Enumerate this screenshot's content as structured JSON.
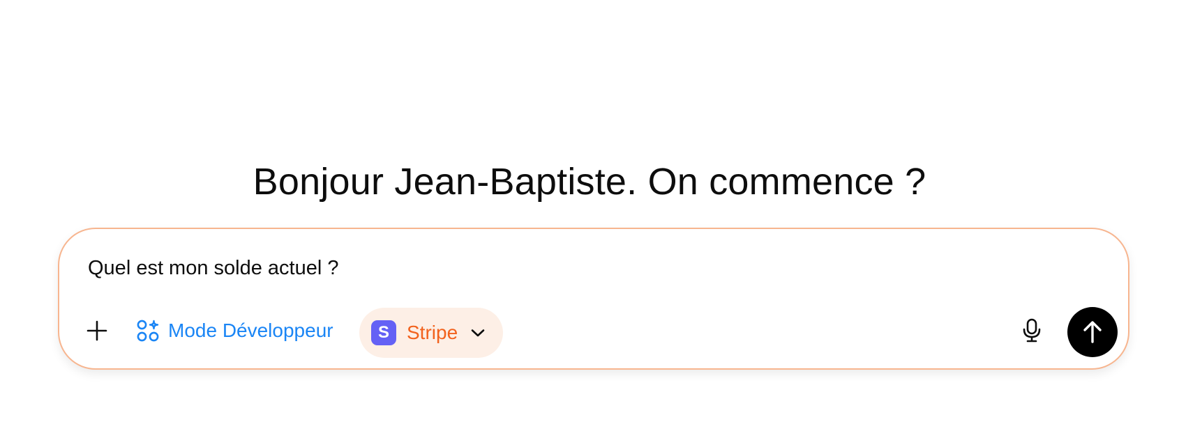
{
  "greeting": "Bonjour Jean-Baptiste. On commence ?",
  "composer": {
    "input_value": "Quel est mon solde actuel ?",
    "dev_mode_label": "Mode Développeur",
    "connector": {
      "label": "Stripe",
      "logo_letter": "S"
    },
    "icons": {
      "add": "plus-icon",
      "dev_mode": "connectors-icon",
      "dropdown": "chevron-down-icon",
      "mic": "microphone-icon",
      "send": "arrow-up-icon"
    }
  },
  "colors": {
    "accent_blue": "#1a85f5",
    "stripe_orange": "#f2621d",
    "stripe_chip_bg": "#fdefe6",
    "stripe_purple": "#6461f5",
    "composer_border": "#f7b58f",
    "send_bg": "#000000"
  }
}
